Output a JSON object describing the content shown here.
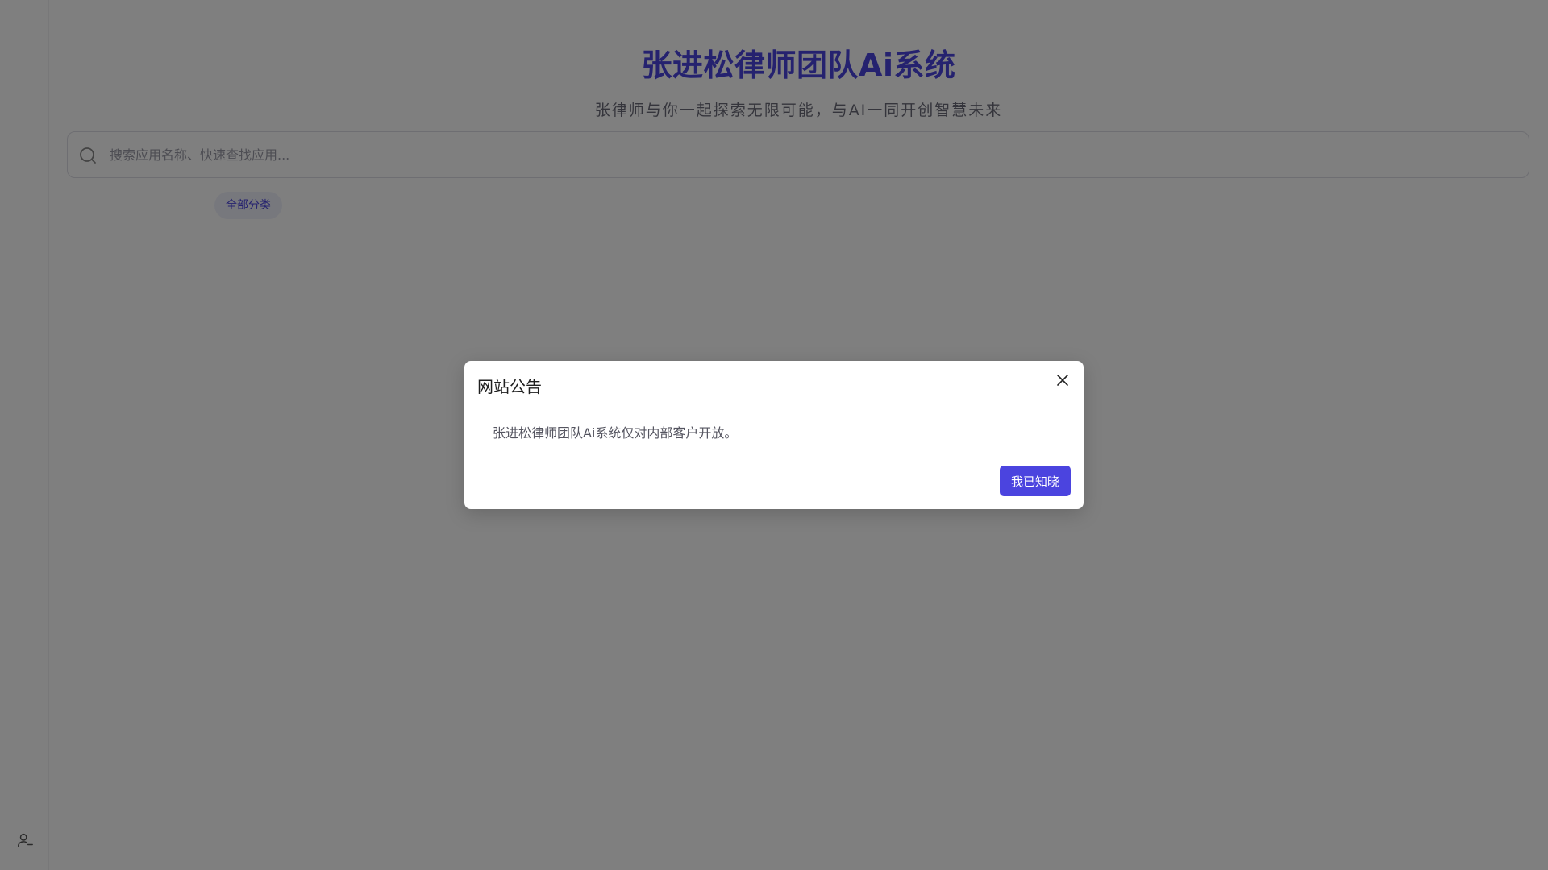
{
  "header": {
    "title": "张进松律师团队Ai系统",
    "subtitle": "张律师与你一起探索无限可能，与AI一同开创智慧未来"
  },
  "search": {
    "placeholder": "搜索应用名称、快速查找应用..."
  },
  "categories": [
    {
      "label": "全部分类",
      "active": true
    }
  ],
  "sidebar": {
    "user_icon": "user-icon"
  },
  "modal": {
    "title": "网站公告",
    "body": "张进松律师团队Ai系统仅对内部客户开放。",
    "confirm_label": "我已知晓"
  },
  "colors": {
    "accent": "#4b44df",
    "overlay": "rgba(0,0,0,0.5)"
  }
}
